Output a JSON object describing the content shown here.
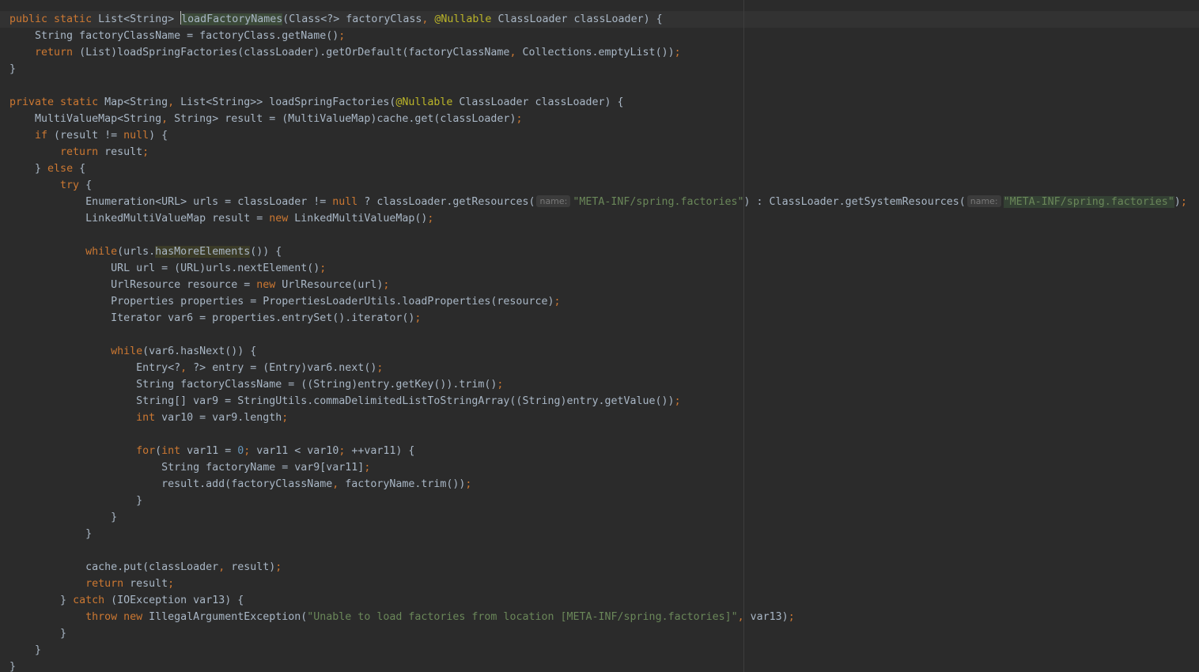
{
  "editor": {
    "lines": [
      [
        [
          "kw",
          "public static "
        ],
        [
          "p",
          "List<String> "
        ],
        [
          "caret",
          ""
        ],
        [
          "usage",
          "loadFactoryNames"
        ],
        [
          "p",
          "(Class<?> factoryClass"
        ],
        [
          "kw",
          ", "
        ],
        [
          "an",
          "@Nullable "
        ],
        [
          "p",
          "ClassLoader classLoader) {"
        ]
      ],
      [
        [
          "p",
          "    String factoryClassName = factoryClass.getName()"
        ],
        [
          "kw",
          ";"
        ]
      ],
      [
        [
          "kw",
          "    return "
        ],
        [
          "p",
          "(List)loadSpringFactories(classLoader).getOrDefault(factoryClassName"
        ],
        [
          "kw",
          ", "
        ],
        [
          "p",
          "Collections.emptyList())"
        ],
        [
          "kw",
          ";"
        ]
      ],
      [
        [
          "p",
          "}"
        ]
      ],
      [],
      [
        [
          "kw",
          "private static "
        ],
        [
          "p",
          "Map<String"
        ],
        [
          "kw",
          ", "
        ],
        [
          "p",
          "List<String>> loadSpringFactories("
        ],
        [
          "an",
          "@Nullable "
        ],
        [
          "p",
          "ClassLoader classLoader) {"
        ]
      ],
      [
        [
          "p",
          "    MultiValueMap<String"
        ],
        [
          "kw",
          ", "
        ],
        [
          "p",
          "String> result = (MultiValueMap)cache.get(classLoader)"
        ],
        [
          "kw",
          ";"
        ]
      ],
      [
        [
          "kw",
          "    if "
        ],
        [
          "p",
          "(result != "
        ],
        [
          "kw",
          "null"
        ],
        [
          "p",
          ") {"
        ]
      ],
      [
        [
          "kw",
          "        return "
        ],
        [
          "p",
          "result"
        ],
        [
          "kw",
          ";"
        ]
      ],
      [
        [
          "p",
          "    } "
        ],
        [
          "kw",
          "else "
        ],
        [
          "p",
          "{"
        ]
      ],
      [
        [
          "kw",
          "        try "
        ],
        [
          "p",
          "{"
        ]
      ],
      [
        [
          "p",
          "            Enumeration<URL> urls = classLoader != "
        ],
        [
          "kw",
          "null "
        ],
        [
          "p",
          "? classLoader.getResources("
        ],
        [
          "hint",
          "name:"
        ],
        [
          "st",
          "\"META-INF/spring.factories\""
        ],
        [
          "p",
          ") : ClassLoader.getSystemResources("
        ],
        [
          "hint",
          "name:"
        ],
        [
          "hl",
          "\"META-INF/spring.factories\""
        ],
        [
          "p",
          ")"
        ],
        [
          "kw",
          ";"
        ]
      ],
      [
        [
          "p",
          "            LinkedMultiValueMap result = "
        ],
        [
          "kw",
          "new "
        ],
        [
          "p",
          "LinkedMultiValueMap()"
        ],
        [
          "kw",
          ";"
        ]
      ],
      [],
      [
        [
          "kw",
          "            while"
        ],
        [
          "p",
          "(urls."
        ],
        [
          "ident",
          "hasMoreElements"
        ],
        [
          "p",
          "()) {"
        ]
      ],
      [
        [
          "p",
          "                URL url = (URL)urls.nextElement()"
        ],
        [
          "kw",
          ";"
        ]
      ],
      [
        [
          "p",
          "                UrlResource resource = "
        ],
        [
          "kw",
          "new "
        ],
        [
          "p",
          "UrlResource(url)"
        ],
        [
          "kw",
          ";"
        ]
      ],
      [
        [
          "p",
          "                Properties properties = PropertiesLoaderUtils.loadProperties(resource)"
        ],
        [
          "kw",
          ";"
        ]
      ],
      [
        [
          "p",
          "                Iterator var6 = properties.entrySet().iterator()"
        ],
        [
          "kw",
          ";"
        ]
      ],
      [],
      [
        [
          "kw",
          "                while"
        ],
        [
          "p",
          "(var6.hasNext()) {"
        ]
      ],
      [
        [
          "p",
          "                    Entry<?"
        ],
        [
          "kw",
          ", "
        ],
        [
          "p",
          "?> entry = (Entry)var6.next()"
        ],
        [
          "kw",
          ";"
        ]
      ],
      [
        [
          "p",
          "                    String factoryClassName = ((String)entry.getKey()).trim()"
        ],
        [
          "kw",
          ";"
        ]
      ],
      [
        [
          "p",
          "                    String[] var9 = StringUtils.commaDelimitedListToStringArray((String)entry.getValue())"
        ],
        [
          "kw",
          ";"
        ]
      ],
      [
        [
          "kw",
          "                    int "
        ],
        [
          "p",
          "var10 = var9.length"
        ],
        [
          "kw",
          ";"
        ]
      ],
      [],
      [
        [
          "kw",
          "                    for"
        ],
        [
          "p",
          "("
        ],
        [
          "kw",
          "int "
        ],
        [
          "p",
          "var11 = "
        ],
        [
          "nm",
          "0"
        ],
        [
          "kw",
          "; "
        ],
        [
          "p",
          "var11 < var10"
        ],
        [
          "kw",
          "; "
        ],
        [
          "p",
          "++var11) {"
        ]
      ],
      [
        [
          "p",
          "                        String factoryName = var9[var11]"
        ],
        [
          "kw",
          ";"
        ]
      ],
      [
        [
          "p",
          "                        result.add(factoryClassName"
        ],
        [
          "kw",
          ", "
        ],
        [
          "p",
          "factoryName.trim())"
        ],
        [
          "kw",
          ";"
        ]
      ],
      [
        [
          "p",
          "                    }"
        ]
      ],
      [
        [
          "p",
          "                }"
        ]
      ],
      [
        [
          "p",
          "            }"
        ]
      ],
      [],
      [
        [
          "p",
          "            cache.put(classLoader"
        ],
        [
          "kw",
          ", "
        ],
        [
          "p",
          "result)"
        ],
        [
          "kw",
          ";"
        ]
      ],
      [
        [
          "kw",
          "            return "
        ],
        [
          "p",
          "result"
        ],
        [
          "kw",
          ";"
        ]
      ],
      [
        [
          "p",
          "        } "
        ],
        [
          "kw",
          "catch "
        ],
        [
          "p",
          "(IOException var13) {"
        ]
      ],
      [
        [
          "kw",
          "            throw new "
        ],
        [
          "p",
          "IllegalArgumentException("
        ],
        [
          "st",
          "\"Unable to load factories from location [META-INF/spring.factories]\""
        ],
        [
          "kw",
          ", "
        ],
        [
          "p",
          "var13)"
        ],
        [
          "kw",
          ";"
        ]
      ],
      [
        [
          "p",
          "        }"
        ]
      ],
      [
        [
          "p",
          "    }"
        ]
      ],
      [
        [
          "p",
          "}"
        ]
      ]
    ]
  },
  "colors": {
    "background": "#2b2b2b",
    "current_line": "#323232",
    "default_text": "#a9b7c6",
    "keyword": "#cc7832",
    "string": "#6a8759",
    "number": "#6897bb",
    "annotation": "#bbb529",
    "inlay_hint": "#787878"
  }
}
